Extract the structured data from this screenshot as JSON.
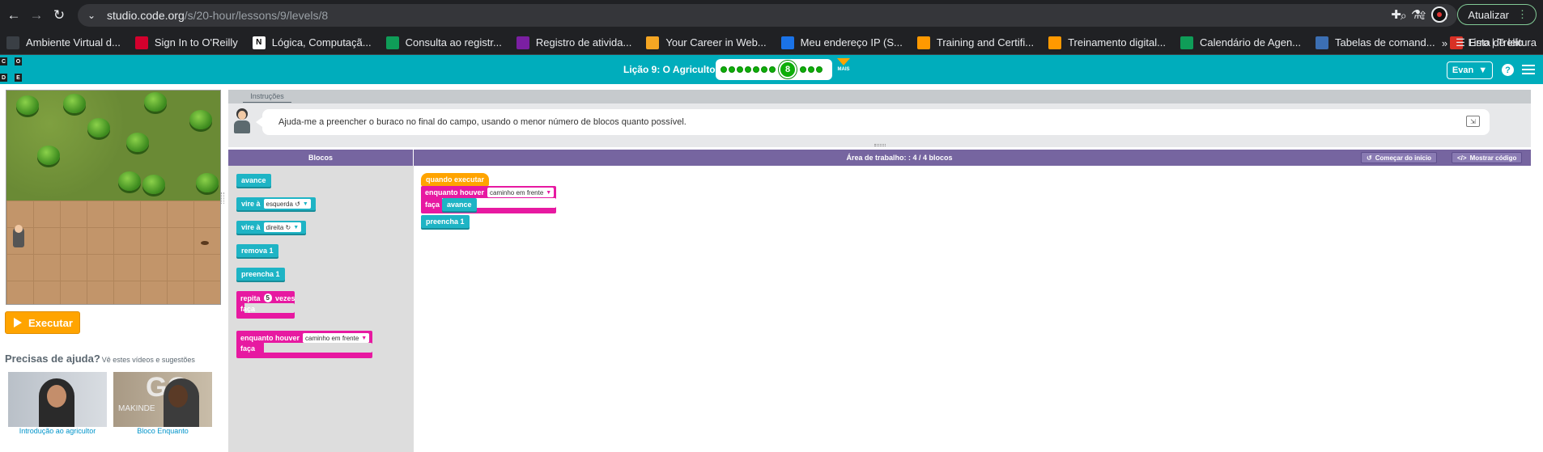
{
  "browser": {
    "url_host": "studio.code.org",
    "url_path": "/s/20-hour/lessons/9/levels/8",
    "update_button": "Atualizar",
    "reading_list": "Lista de leitura",
    "bookmarks": [
      {
        "label": "Ambiente Virtual d...",
        "color": "#3a3f45"
      },
      {
        "label": "Sign In to O'Reilly",
        "color": "#d3002d"
      },
      {
        "label": "Lógica, Computaçã...",
        "color": "#ffffff"
      },
      {
        "label": "Consulta ao registr...",
        "color": "#0f9d58"
      },
      {
        "label": "Registro de ativida...",
        "color": "#7b1fa2"
      },
      {
        "label": "Your Career in Web...",
        "color": "#f5a623"
      },
      {
        "label": "Meu endereço IP (S...",
        "color": "#1a73e8"
      },
      {
        "label": "Training and Certifi...",
        "color": "#ff9900"
      },
      {
        "label": "Treinamento digital...",
        "color": "#ff9900"
      },
      {
        "label": "Calendário de Agen...",
        "color": "#0f9d58"
      },
      {
        "label": "Tabelas de comand...",
        "color": "#3c6fb3"
      },
      {
        "label": "Erro | Trello",
        "color": "#d93025"
      }
    ]
  },
  "header": {
    "logo_letters": [
      "C",
      "O",
      "D",
      "E"
    ],
    "lesson_title": "Lição 9: O Agricultor",
    "current_level": "8",
    "more_label": "MAIS",
    "user_name": "Evan",
    "colors": {
      "brand": "#00adbc",
      "progress_done": "#0eae09"
    }
  },
  "left": {
    "run_button": "Executar",
    "help_title": "Precisas de ajuda?",
    "help_subtitle": "Vê estes vídeos e sugestões",
    "videos": [
      {
        "caption": "Introdução ao agricultor"
      },
      {
        "caption": "Bloco Enquanto",
        "overlay": "GO",
        "overlay2": "MAKINDE"
      }
    ]
  },
  "instructions": {
    "tab": "Instruções",
    "text": "Ajuda-me a preencher o buraco no final do campo, usando o menor número de blocos quanto possível."
  },
  "workspace": {
    "toolbox_title": "Blocos",
    "workspace_title": "Área de trabalho: : 4 / 4 blocos",
    "start_over": "Começar do início",
    "show_code": "Mostrar código"
  },
  "toolbox_blocks": {
    "move": "avance",
    "turn_left_prefix": "vire à",
    "turn_left_value": "esquerda ↺",
    "turn_right_prefix": "vire à",
    "turn_right_value": "direita ↻",
    "dig": "remova 1",
    "fill": "preencha 1",
    "repeat_prefix": "repita",
    "repeat_count": "5",
    "repeat_suffix": "vezes",
    "repeat_do": "faça",
    "while_prefix": "enquanto houver",
    "while_value": "caminho em frente",
    "while_do": "faça"
  },
  "program": {
    "when_run": "quando executar",
    "while_prefix": "enquanto houver",
    "while_value": "caminho em frente",
    "while_do": "faça",
    "inner": "avance",
    "after": "preencha 1"
  }
}
